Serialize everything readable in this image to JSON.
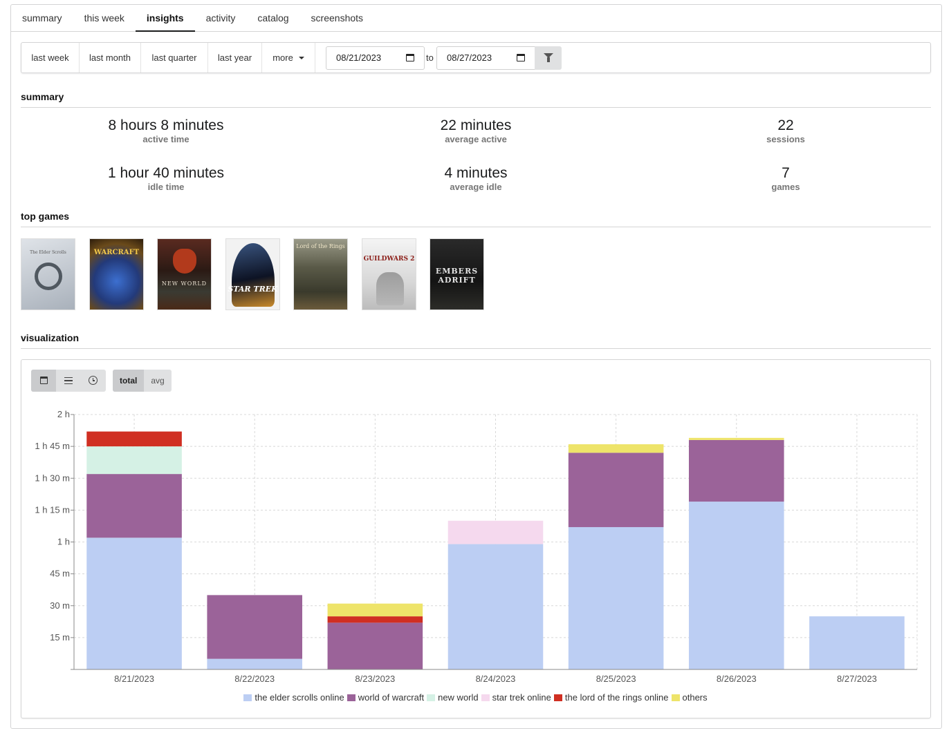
{
  "tabs": [
    "summary",
    "this week",
    "insights",
    "activity",
    "catalog",
    "screenshots"
  ],
  "active_tab": "insights",
  "filter": {
    "presets": [
      "last week",
      "last month",
      "last quarter",
      "last year"
    ],
    "more_label": "more",
    "start_date": "08/21/2023",
    "end_date": "08/27/2023",
    "to_label": "to"
  },
  "summary": {
    "heading": "summary",
    "active_time": {
      "value": "8 hours 8 minutes",
      "label": "active time"
    },
    "average_active": {
      "value": "22 minutes",
      "label": "average active"
    },
    "sessions": {
      "value": "22",
      "label": "sessions"
    },
    "idle_time": {
      "value": "1 hour 40 minutes",
      "label": "idle time"
    },
    "average_idle": {
      "value": "4 minutes",
      "label": "average idle"
    },
    "games": {
      "value": "7",
      "label": "games"
    }
  },
  "top_games": {
    "heading": "top games",
    "covers": [
      {
        "name": "the elder scrolls online",
        "art_text": "The Elder Scrolls"
      },
      {
        "name": "world of warcraft",
        "art_text": "WARCRAFT"
      },
      {
        "name": "new world",
        "art_text": "NEW WORLD"
      },
      {
        "name": "star trek online",
        "art_text": "STAR TREK"
      },
      {
        "name": "the lord of the rings online",
        "art_text": "Lord of the Rings"
      },
      {
        "name": "guild wars 2",
        "art_text": "GUILDWARS 2"
      },
      {
        "name": "embers adrift",
        "art_text": "EMBERS ADRIFT"
      }
    ]
  },
  "visualization": {
    "heading": "visualization",
    "view_icons": [
      "calendar-icon",
      "list-icon",
      "clock-icon"
    ],
    "mode_buttons": [
      "total",
      "avg"
    ],
    "active_mode": "total"
  },
  "chart_data": {
    "type": "bar",
    "stacked": true,
    "categories": [
      "8/21/2023",
      "8/22/2023",
      "8/23/2023",
      "8/24/2023",
      "8/25/2023",
      "8/26/2023",
      "8/27/2023"
    ],
    "y_unit": "minutes",
    "ylim": [
      0,
      120
    ],
    "yticks": [
      {
        "value": 15,
        "label": "15 m"
      },
      {
        "value": 30,
        "label": "30 m"
      },
      {
        "value": 45,
        "label": "45 m"
      },
      {
        "value": 60,
        "label": "1 h"
      },
      {
        "value": 75,
        "label": "1 h 15 m"
      },
      {
        "value": 90,
        "label": "1 h 30 m"
      },
      {
        "value": 105,
        "label": "1 h 45 m"
      },
      {
        "value": 120,
        "label": "2 h"
      }
    ],
    "grid": true,
    "legend_position": "bottom",
    "series": [
      {
        "name": "the elder scrolls online",
        "color": "#bccef3",
        "values": [
          62,
          5,
          0,
          59,
          67,
          79,
          25
        ]
      },
      {
        "name": "world of warcraft",
        "color": "#9b6399",
        "values": [
          30,
          30,
          22,
          0,
          35,
          29,
          0
        ]
      },
      {
        "name": "new world",
        "color": "#d5f1e5",
        "values": [
          13,
          0,
          0,
          0,
          0,
          0,
          0
        ]
      },
      {
        "name": "star trek online",
        "color": "#f5d9ee",
        "values": [
          0,
          0,
          0,
          11,
          0,
          0,
          0
        ]
      },
      {
        "name": "the lord of the rings online",
        "color": "#d02f22",
        "values": [
          7,
          0,
          3,
          0,
          0,
          0,
          0
        ]
      },
      {
        "name": "others",
        "color": "#eee46a",
        "values": [
          0,
          0,
          6,
          0,
          4,
          1,
          0
        ]
      }
    ]
  }
}
